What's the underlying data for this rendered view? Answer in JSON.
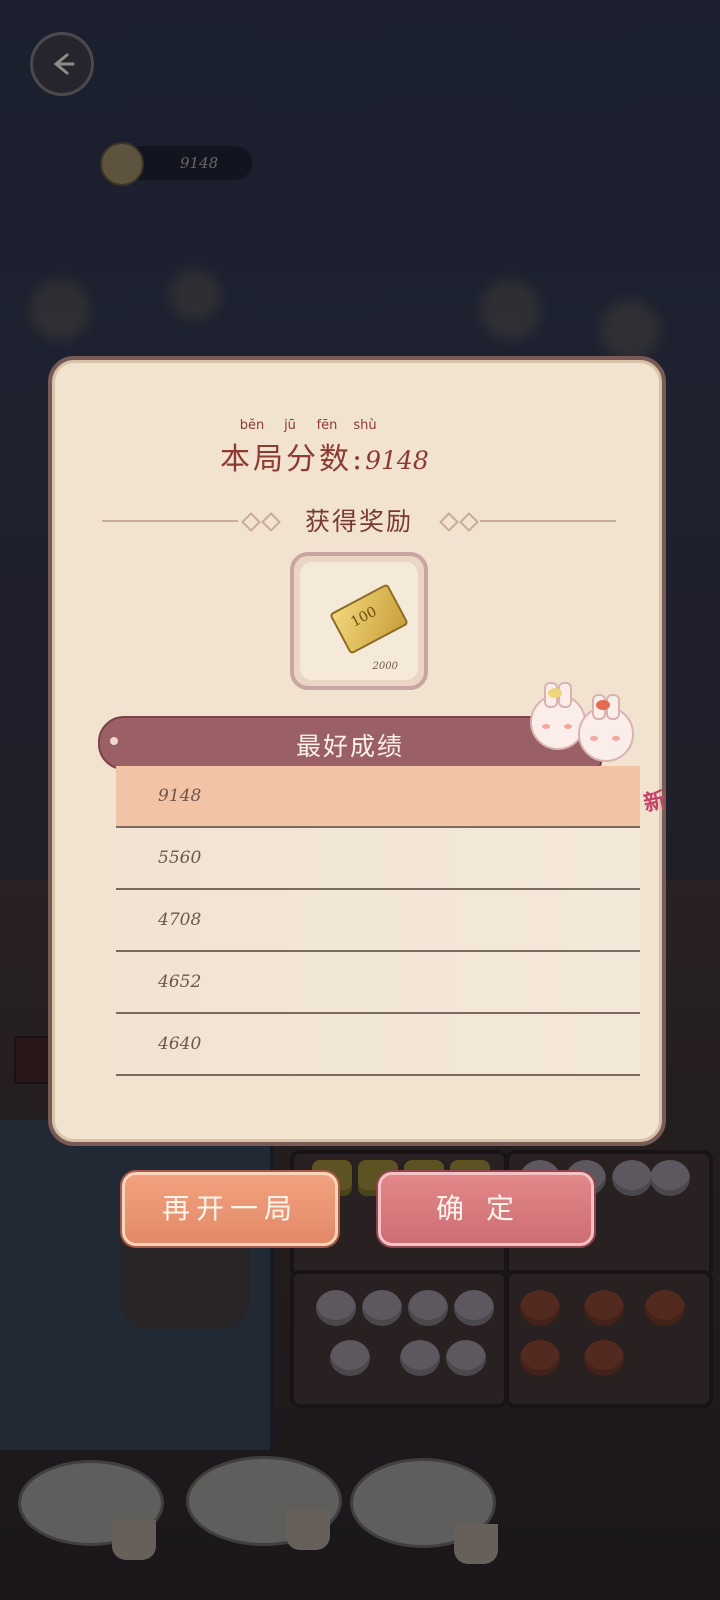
{
  "hud": {
    "coin_score": "9148"
  },
  "result_panel": {
    "pinyin": [
      "bĕn",
      "jū",
      "fēn",
      "shù"
    ],
    "round_score_label": "本局分数:",
    "round_score_value": "9148",
    "reward_title": "获得奖励",
    "reward": {
      "icon": "ticket-100-icon",
      "ticket_text": "100",
      "quantity": "2000"
    },
    "best_title": "最好成绩",
    "best_scores": [
      {
        "value": "9148",
        "is_new": true
      },
      {
        "value": "5560",
        "is_new": false
      },
      {
        "value": "4708",
        "is_new": false
      },
      {
        "value": "4652",
        "is_new": false
      },
      {
        "value": "4640",
        "is_new": false
      }
    ],
    "new_badge": "新"
  },
  "buttons": {
    "replay_label": "再开一局",
    "confirm_label": "确定"
  },
  "colors": {
    "panel_bg": "#f1e3cf",
    "panel_border": "#7a5a56",
    "title_red": "#8c3a32",
    "best_header": "#9b5f66",
    "new_row": "#f2c3a4",
    "replay_button": "#e28a69",
    "confirm_button": "#cd6e74"
  }
}
